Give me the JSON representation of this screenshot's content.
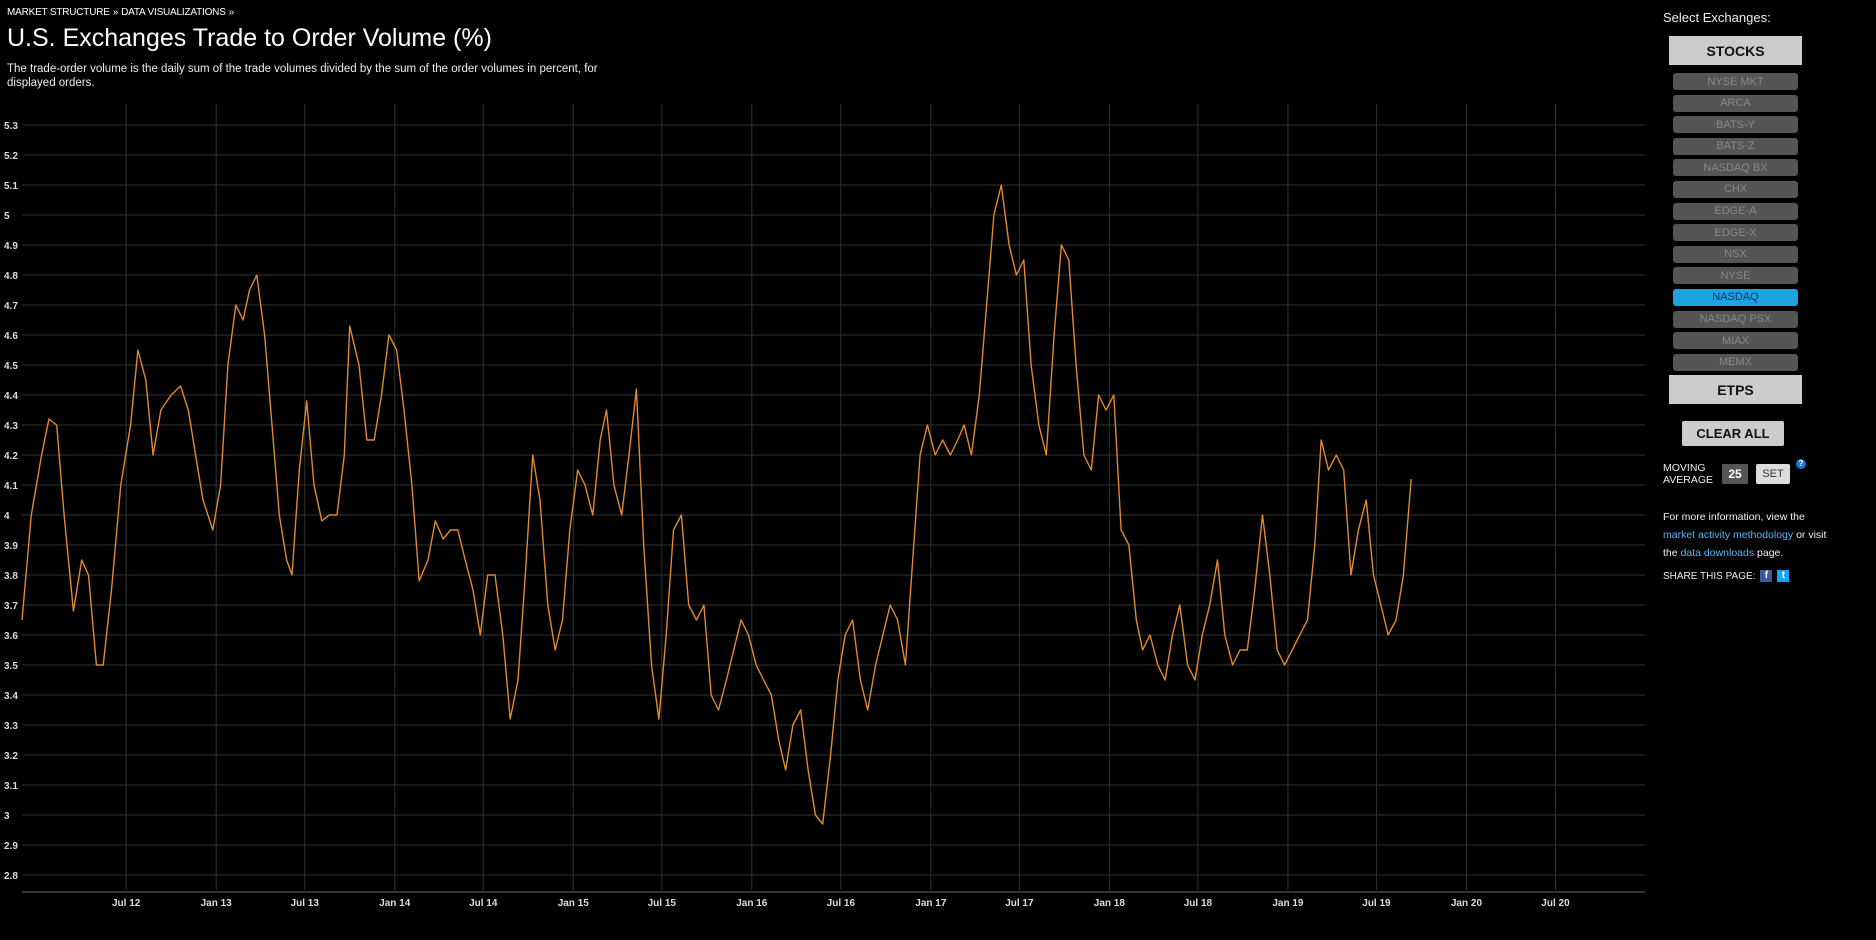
{
  "breadcrumb": {
    "item1": "MARKET STRUCTURE",
    "sep1": "»",
    "item2": "DATA VISUALIZATIONS",
    "sep2": "»"
  },
  "page": {
    "title": "U.S. Exchanges Trade to Order Volume (%)",
    "description": "The trade-order volume is the daily sum of the trade volumes divided by the sum of the order volumes in percent, for displayed orders."
  },
  "sidebar": {
    "select_label": "Select Exchanges:",
    "stocks_label": "STOCKS",
    "etps_label": "ETPS",
    "exchanges": [
      {
        "label": "NYSE MKT",
        "active": false
      },
      {
        "label": "ARCA",
        "active": false
      },
      {
        "label": "BATS-Y",
        "active": false
      },
      {
        "label": "BATS-Z",
        "active": false
      },
      {
        "label": "NASDAQ BX",
        "active": false
      },
      {
        "label": "CHX",
        "active": false
      },
      {
        "label": "EDGE-A",
        "active": false
      },
      {
        "label": "EDGE-X",
        "active": false
      },
      {
        "label": "NSX",
        "active": false
      },
      {
        "label": "NYSE",
        "active": false
      },
      {
        "label": "NASDAQ",
        "active": true
      },
      {
        "label": "NASDAQ PSX",
        "active": false
      },
      {
        "label": "MIAX",
        "active": false
      },
      {
        "label": "MEMX",
        "active": false
      }
    ],
    "clear_all_label": "CLEAR ALL",
    "moving_average_label_1": "MOVING",
    "moving_average_label_2": "AVERAGE",
    "moving_average_value": "25",
    "set_label": "SET",
    "help_icon": "?",
    "info_text_1": "For more information, view the",
    "info_link_1": "market activity methodology",
    "info_text_2": "or visit the",
    "info_link_2": "data downloads",
    "info_text_3": "page.",
    "share_label": "SHARE THIS PAGE:",
    "facebook_icon": "f",
    "twitter_icon": "t"
  },
  "colors": {
    "line": "#e08a2c",
    "grid": "#333333",
    "active_exchange": "#1ea2e0"
  },
  "chart_data": {
    "type": "line",
    "title": "",
    "xlabel": "",
    "ylabel": "",
    "grid": true,
    "ylim": [
      2.75,
      5.35
    ],
    "xlim": [
      "2011-12-01",
      "2020-12-31"
    ],
    "y_ticks": [
      "2.8",
      "2.9",
      "3",
      "3.1",
      "3.2",
      "3.3",
      "3.4",
      "3.5",
      "3.6",
      "3.7",
      "3.8",
      "3.9",
      "4",
      "4.1",
      "4.2",
      "4.3",
      "4.4",
      "4.5",
      "4.6",
      "4.7",
      "4.8",
      "4.9",
      "5",
      "5.1",
      "5.2",
      "5.3"
    ],
    "x_ticks": [
      {
        "label": "Jul 12",
        "date": "2012-07-01"
      },
      {
        "label": "Jan 13",
        "date": "2013-01-01"
      },
      {
        "label": "Jul 13",
        "date": "2013-07-01"
      },
      {
        "label": "Jan 14",
        "date": "2014-01-01"
      },
      {
        "label": "Jul 14",
        "date": "2014-07-01"
      },
      {
        "label": "Jan 15",
        "date": "2015-01-01"
      },
      {
        "label": "Jul 15",
        "date": "2015-07-01"
      },
      {
        "label": "Jan 16",
        "date": "2016-01-01"
      },
      {
        "label": "Jul 16",
        "date": "2016-07-01"
      },
      {
        "label": "Jan 17",
        "date": "2017-01-01"
      },
      {
        "label": "Jul 17",
        "date": "2017-07-01"
      },
      {
        "label": "Jan 18",
        "date": "2018-01-01"
      },
      {
        "label": "Jul 18",
        "date": "2018-07-01"
      },
      {
        "label": "Jan 19",
        "date": "2019-01-01"
      },
      {
        "label": "Jul 19",
        "date": "2019-07-01"
      },
      {
        "label": "Jan 20",
        "date": "2020-01-01"
      },
      {
        "label": "Jul 20",
        "date": "2020-07-01"
      }
    ],
    "series": [
      {
        "name": "NASDAQ",
        "points": [
          [
            "2011-12-01",
            3.65
          ],
          [
            "2011-12-20",
            4.0
          ],
          [
            "2012-01-10",
            4.2
          ],
          [
            "2012-01-25",
            4.32
          ],
          [
            "2012-02-10",
            4.3
          ],
          [
            "2012-02-25",
            4.0
          ],
          [
            "2012-03-15",
            3.68
          ],
          [
            "2012-04-01",
            3.85
          ],
          [
            "2012-04-15",
            3.8
          ],
          [
            "2012-05-01",
            3.5
          ],
          [
            "2012-05-15",
            3.5
          ],
          [
            "2012-06-01",
            3.75
          ],
          [
            "2012-06-20",
            4.1
          ],
          [
            "2012-07-10",
            4.3
          ],
          [
            "2012-07-25",
            4.55
          ],
          [
            "2012-08-10",
            4.45
          ],
          [
            "2012-08-25",
            4.2
          ],
          [
            "2012-09-10",
            4.35
          ],
          [
            "2012-10-01",
            4.4
          ],
          [
            "2012-10-20",
            4.43
          ],
          [
            "2012-11-05",
            4.35
          ],
          [
            "2012-11-20",
            4.2
          ],
          [
            "2012-12-05",
            4.05
          ],
          [
            "2012-12-25",
            3.95
          ],
          [
            "2013-01-10",
            4.1
          ],
          [
            "2013-01-25",
            4.5
          ],
          [
            "2013-02-10",
            4.7
          ],
          [
            "2013-02-25",
            4.65
          ],
          [
            "2013-03-10",
            4.75
          ],
          [
            "2013-03-25",
            4.8
          ],
          [
            "2013-04-10",
            4.6
          ],
          [
            "2013-04-25",
            4.3
          ],
          [
            "2013-05-10",
            4.0
          ],
          [
            "2013-05-25",
            3.85
          ],
          [
            "2013-06-05",
            3.8
          ],
          [
            "2013-06-20",
            4.15
          ],
          [
            "2013-07-05",
            4.38
          ],
          [
            "2013-07-20",
            4.1
          ],
          [
            "2013-08-05",
            3.98
          ],
          [
            "2013-08-20",
            4.0
          ],
          [
            "2013-09-05",
            4.0
          ],
          [
            "2013-09-20",
            4.2
          ],
          [
            "2013-10-01",
            4.63
          ],
          [
            "2013-10-20",
            4.5
          ],
          [
            "2013-11-05",
            4.25
          ],
          [
            "2013-11-20",
            4.25
          ],
          [
            "2013-12-05",
            4.4
          ],
          [
            "2013-12-20",
            4.6
          ],
          [
            "2014-01-05",
            4.55
          ],
          [
            "2014-01-20",
            4.35
          ],
          [
            "2014-02-05",
            4.1
          ],
          [
            "2014-02-20",
            3.78
          ],
          [
            "2014-03-10",
            3.85
          ],
          [
            "2014-03-25",
            3.98
          ],
          [
            "2014-04-10",
            3.92
          ],
          [
            "2014-04-25",
            3.95
          ],
          [
            "2014-05-10",
            3.95
          ],
          [
            "2014-05-25",
            3.85
          ],
          [
            "2014-06-10",
            3.75
          ],
          [
            "2014-06-25",
            3.6
          ],
          [
            "2014-07-10",
            3.8
          ],
          [
            "2014-07-25",
            3.8
          ],
          [
            "2014-08-10",
            3.6
          ],
          [
            "2014-08-25",
            3.32
          ],
          [
            "2014-09-10",
            3.45
          ],
          [
            "2014-09-25",
            3.8
          ],
          [
            "2014-10-10",
            4.2
          ],
          [
            "2014-10-25",
            4.05
          ],
          [
            "2014-11-10",
            3.7
          ],
          [
            "2014-11-25",
            3.55
          ],
          [
            "2014-12-10",
            3.65
          ],
          [
            "2014-12-25",
            3.95
          ],
          [
            "2015-01-10",
            4.15
          ],
          [
            "2015-01-25",
            4.1
          ],
          [
            "2015-02-10",
            4.0
          ],
          [
            "2015-02-25",
            4.25
          ],
          [
            "2015-03-10",
            4.35
          ],
          [
            "2015-03-25",
            4.1
          ],
          [
            "2015-04-10",
            4.0
          ],
          [
            "2015-04-25",
            4.2
          ],
          [
            "2015-05-10",
            4.42
          ],
          [
            "2015-05-25",
            3.9
          ],
          [
            "2015-06-10",
            3.5
          ],
          [
            "2015-06-25",
            3.32
          ],
          [
            "2015-07-10",
            3.6
          ],
          [
            "2015-07-25",
            3.95
          ],
          [
            "2015-08-10",
            4.0
          ],
          [
            "2015-08-25",
            3.7
          ],
          [
            "2015-09-10",
            3.65
          ],
          [
            "2015-09-25",
            3.7
          ],
          [
            "2015-10-10",
            3.4
          ],
          [
            "2015-10-25",
            3.35
          ],
          [
            "2015-11-10",
            3.45
          ],
          [
            "2015-11-25",
            3.55
          ],
          [
            "2015-12-10",
            3.65
          ],
          [
            "2015-12-25",
            3.6
          ],
          [
            "2016-01-10",
            3.5
          ],
          [
            "2016-01-25",
            3.45
          ],
          [
            "2016-02-10",
            3.4
          ],
          [
            "2016-02-25",
            3.25
          ],
          [
            "2016-03-10",
            3.15
          ],
          [
            "2016-03-25",
            3.3
          ],
          [
            "2016-04-10",
            3.35
          ],
          [
            "2016-04-25",
            3.15
          ],
          [
            "2016-05-10",
            3.0
          ],
          [
            "2016-05-25",
            2.97
          ],
          [
            "2016-06-10",
            3.2
          ],
          [
            "2016-06-25",
            3.45
          ],
          [
            "2016-07-10",
            3.6
          ],
          [
            "2016-07-25",
            3.65
          ],
          [
            "2016-08-10",
            3.45
          ],
          [
            "2016-08-25",
            3.35
          ],
          [
            "2016-09-10",
            3.5
          ],
          [
            "2016-09-25",
            3.6
          ],
          [
            "2016-10-10",
            3.7
          ],
          [
            "2016-10-25",
            3.65
          ],
          [
            "2016-11-10",
            3.5
          ],
          [
            "2016-11-25",
            3.85
          ],
          [
            "2016-12-10",
            4.2
          ],
          [
            "2016-12-25",
            4.3
          ],
          [
            "2017-01-10",
            4.2
          ],
          [
            "2017-01-25",
            4.25
          ],
          [
            "2017-02-10",
            4.2
          ],
          [
            "2017-02-25",
            4.25
          ],
          [
            "2017-03-10",
            4.3
          ],
          [
            "2017-03-25",
            4.2
          ],
          [
            "2017-04-10",
            4.4
          ],
          [
            "2017-04-25",
            4.7
          ],
          [
            "2017-05-10",
            5.0
          ],
          [
            "2017-05-25",
            5.1
          ],
          [
            "2017-06-10",
            4.9
          ],
          [
            "2017-06-25",
            4.8
          ],
          [
            "2017-07-10",
            4.85
          ],
          [
            "2017-07-25",
            4.5
          ],
          [
            "2017-08-10",
            4.3
          ],
          [
            "2017-08-25",
            4.2
          ],
          [
            "2017-09-10",
            4.6
          ],
          [
            "2017-09-25",
            4.9
          ],
          [
            "2017-10-10",
            4.85
          ],
          [
            "2017-10-25",
            4.5
          ],
          [
            "2017-11-10",
            4.2
          ],
          [
            "2017-11-25",
            4.15
          ],
          [
            "2017-12-10",
            4.4
          ],
          [
            "2017-12-25",
            4.35
          ],
          [
            "2018-01-10",
            4.4
          ],
          [
            "2018-01-25",
            3.95
          ],
          [
            "2018-02-10",
            3.9
          ],
          [
            "2018-02-25",
            3.65
          ],
          [
            "2018-03-10",
            3.55
          ],
          [
            "2018-03-25",
            3.6
          ],
          [
            "2018-04-10",
            3.5
          ],
          [
            "2018-04-25",
            3.45
          ],
          [
            "2018-05-10",
            3.6
          ],
          [
            "2018-05-25",
            3.7
          ],
          [
            "2018-06-10",
            3.5
          ],
          [
            "2018-06-25",
            3.45
          ],
          [
            "2018-07-10",
            3.6
          ],
          [
            "2018-07-25",
            3.7
          ],
          [
            "2018-08-10",
            3.85
          ],
          [
            "2018-08-25",
            3.6
          ],
          [
            "2018-09-10",
            3.5
          ],
          [
            "2018-09-25",
            3.55
          ],
          [
            "2018-10-10",
            3.55
          ],
          [
            "2018-10-25",
            3.75
          ],
          [
            "2018-11-10",
            4.0
          ],
          [
            "2018-11-25",
            3.8
          ],
          [
            "2018-12-10",
            3.55
          ],
          [
            "2018-12-25",
            3.5
          ],
          [
            "2019-01-10",
            3.55
          ],
          [
            "2019-01-25",
            3.6
          ],
          [
            "2019-02-10",
            3.65
          ],
          [
            "2019-02-25",
            3.9
          ],
          [
            "2019-03-10",
            4.25
          ],
          [
            "2019-03-25",
            4.15
          ],
          [
            "2019-04-10",
            4.2
          ],
          [
            "2019-04-25",
            4.15
          ],
          [
            "2019-05-10",
            3.8
          ],
          [
            "2019-05-25",
            3.95
          ],
          [
            "2019-06-10",
            4.05
          ],
          [
            "2019-06-25",
            3.8
          ],
          [
            "2019-07-10",
            3.7
          ],
          [
            "2019-07-25",
            3.6
          ],
          [
            "2019-08-10",
            3.65
          ],
          [
            "2019-08-25",
            3.8
          ],
          [
            "2019-09-10",
            4.12
          ]
        ]
      }
    ]
  }
}
